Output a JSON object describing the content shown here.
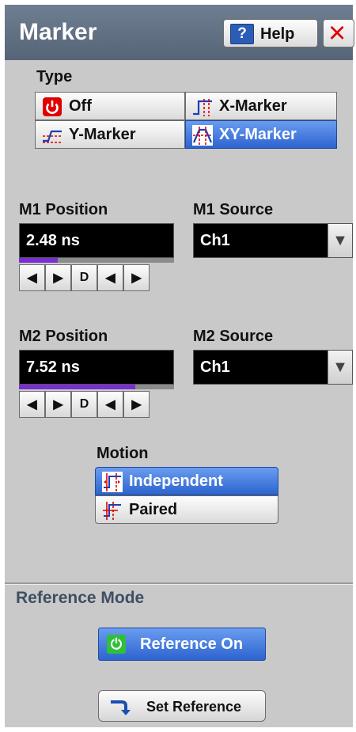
{
  "header": {
    "title": "Marker",
    "help_label": "Help",
    "help_icon_glyph": "?",
    "close_glyph": "×"
  },
  "type": {
    "label": "Type",
    "options": [
      {
        "label": "Off",
        "icon": "power-icon",
        "selected": false
      },
      {
        "label": "X-Marker",
        "icon": "x-marker-icon",
        "selected": false
      },
      {
        "label": "Y-Marker",
        "icon": "y-marker-icon",
        "selected": false
      },
      {
        "label": "XY-Marker",
        "icon": "xy-marker-icon",
        "selected": true
      }
    ]
  },
  "m1": {
    "position_label": "M1 Position",
    "position_value": "2.48 ns",
    "position_fraction": 0.25,
    "source_label": "M1 Source",
    "source_value": "Ch1"
  },
  "m2": {
    "position_label": "M2 Position",
    "position_value": "7.52 ns",
    "position_fraction": 0.75,
    "source_label": "M2 Source",
    "source_value": "Ch1"
  },
  "arrow_buttons": [
    "◀",
    "▶",
    "D",
    "◀",
    "▶"
  ],
  "motion": {
    "label": "Motion",
    "options": [
      {
        "label": "Independent",
        "selected": true
      },
      {
        "label": "Paired",
        "selected": false
      }
    ]
  },
  "reference": {
    "label": "Reference Mode",
    "on_label": "Reference On",
    "set_label": "Set Reference"
  },
  "colors": {
    "selected_blue": "#2d64cf",
    "marker_purple": "#7a2fd0",
    "off_red": "#e00000",
    "on_green": "#2fbf3a"
  }
}
